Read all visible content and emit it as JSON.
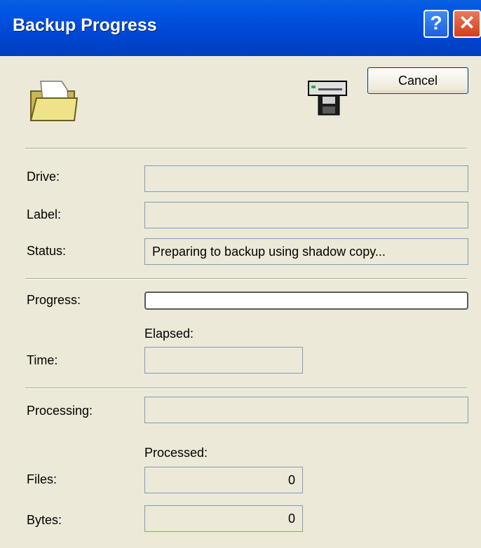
{
  "window": {
    "title": "Backup Progress",
    "help_label": "?",
    "close_label": "✕"
  },
  "buttons": {
    "cancel": "Cancel"
  },
  "icons": {
    "folder": "open-folder-icon",
    "drive": "backup-drive-icon"
  },
  "fields": {
    "drive": {
      "label": "Drive:",
      "value": ""
    },
    "label": {
      "label": "Label:",
      "value": ""
    },
    "status": {
      "label": "Status:",
      "value": "Preparing to backup using shadow copy..."
    }
  },
  "progress": {
    "label": "Progress:",
    "percent": 0
  },
  "time": {
    "header": "Elapsed:",
    "label": "Time:",
    "value": ""
  },
  "processing": {
    "label": "Processing:",
    "value": ""
  },
  "processed": {
    "header": "Processed:",
    "files_label": "Files:",
    "files_value": "0",
    "bytes_label": "Bytes:",
    "bytes_value": "0"
  }
}
